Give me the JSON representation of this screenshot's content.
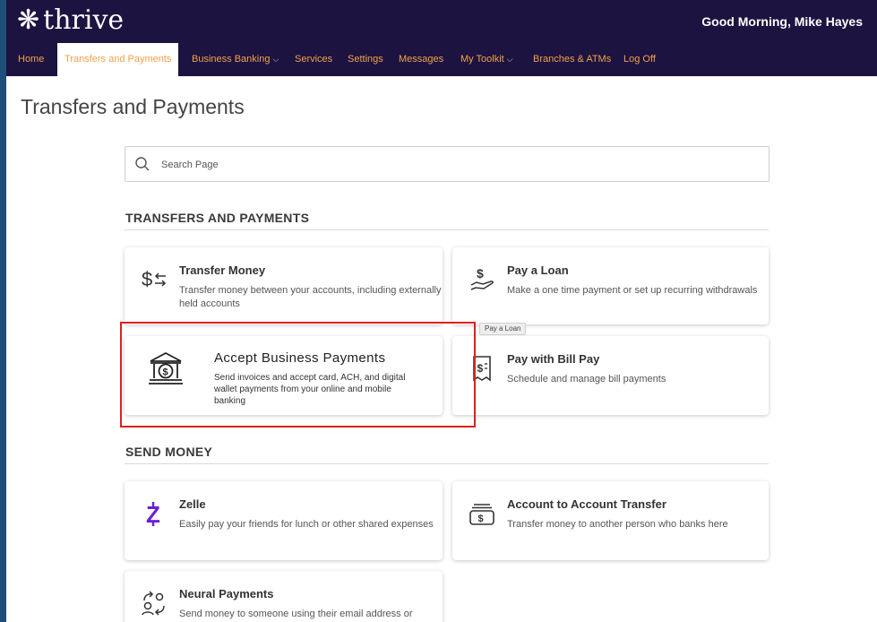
{
  "header": {
    "logo_text": "thrive",
    "greeting": "Good Morning, Mike Hayes"
  },
  "nav": {
    "items": [
      {
        "label": "Home"
      },
      {
        "label": "Transfers and Payments",
        "active": true
      },
      {
        "label": "Business Banking",
        "dropdown": true
      },
      {
        "label": "Services"
      },
      {
        "label": "Settings"
      },
      {
        "label": "Messages"
      },
      {
        "label": "My Toolkit",
        "dropdown": true
      },
      {
        "label": "Branches & ATMs"
      },
      {
        "label": "Log Off"
      }
    ]
  },
  "page": {
    "title": "Transfers and Payments"
  },
  "search": {
    "placeholder": "Search Page",
    "value": ""
  },
  "sections": [
    {
      "title": "TRANSFERS AND PAYMENTS",
      "cards": [
        {
          "title": "Transfer Money",
          "description": "Transfer money between your accounts, including externally held accounts",
          "icon": "dollar-transfer-icon"
        },
        {
          "title": "Pay a Loan",
          "description": "Make a one time payment or set up recurring withdrawals",
          "icon": "hand-dollar-icon"
        },
        {
          "title": "Accept Business Payments",
          "description": "Send invoices and accept card, ACH, and digital wallet payments from your online and mobile banking",
          "icon": "bank-dollar-icon"
        },
        {
          "title": "Pay with Bill Pay",
          "description": "Schedule and manage bill payments",
          "icon": "bill-receipt-icon"
        }
      ]
    },
    {
      "title": "SEND MONEY",
      "cards": [
        {
          "title": "Zelle",
          "description": "Easily pay your friends for lunch or other shared expenses",
          "icon": "zelle-icon"
        },
        {
          "title": "Account to Account Transfer",
          "description": "Transfer money to another person who banks here",
          "icon": "cash-transfer-icon"
        },
        {
          "title": "Neural Payments",
          "description": "Send money to someone using their email address or",
          "icon": "people-exchange-icon"
        }
      ]
    }
  ],
  "tooltip": {
    "text": "Pay a Loan"
  },
  "colors": {
    "header_bg": "#1c1340",
    "nav_text": "#f2a14a",
    "highlight": "#e02020",
    "zelle": "#6d1ed4"
  }
}
